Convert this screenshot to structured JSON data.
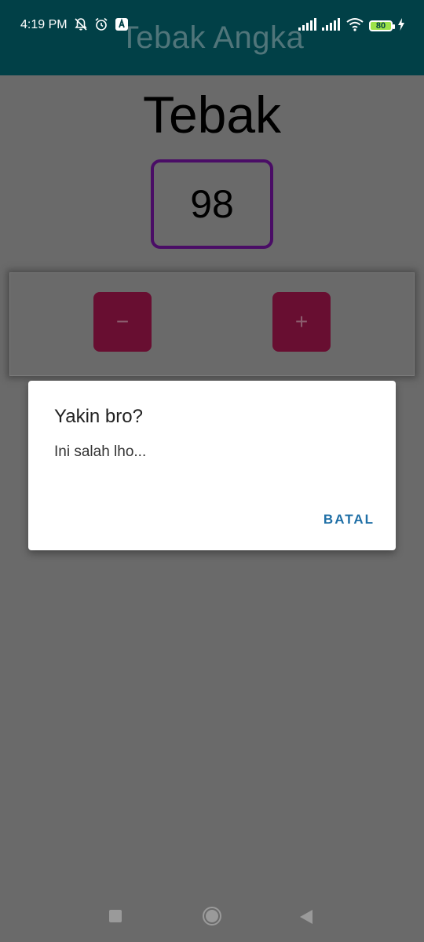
{
  "status_bar": {
    "time": "4:19 PM",
    "battery_level": "80",
    "left_icons": [
      "bell-off-icon",
      "alarm-icon",
      "app-notification-icon"
    ],
    "right_icons": [
      "signal-icon",
      "signal-icon",
      "wifi-icon",
      "battery-icon",
      "charging-icon"
    ]
  },
  "app_bar": {
    "title": "Tebak Angka",
    "color": "#014047"
  },
  "main": {
    "heading": "Tebak",
    "number": "98",
    "minus_label": "−",
    "plus_label": "+",
    "button_color": "#680e31",
    "box_border_color": "#4a0d66"
  },
  "dialog": {
    "title": "Yakin bro?",
    "message": "Ini salah lho...",
    "action_label": "BATAL",
    "action_color": "#1f6fa6"
  },
  "nav_bar": {
    "icons": [
      "recents-icon",
      "home-icon",
      "back-icon"
    ]
  }
}
